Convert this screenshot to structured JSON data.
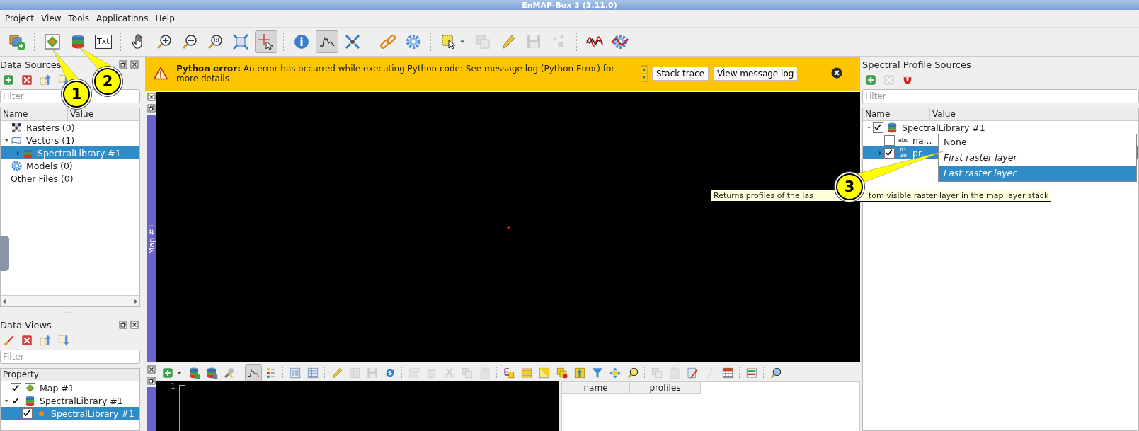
{
  "window": {
    "title": "EnMAP-Box 3 (3.11.0)"
  },
  "menu": [
    "Project",
    "View",
    "Tools",
    "Applications",
    "Help"
  ],
  "toolbar": [
    {
      "pressed": false,
      "disabled": false
    },
    {
      "pressed": false,
      "disabled": false
    },
    {
      "pressed": false,
      "disabled": false
    },
    {
      "pressed": false,
      "disabled": false,
      "label": "Txt"
    },
    {
      "pressed": false,
      "disabled": false
    },
    {
      "pressed": false,
      "disabled": false
    },
    {
      "pressed": false,
      "disabled": false
    },
    {
      "pressed": false,
      "disabled": false
    },
    {
      "pressed": false,
      "disabled": false
    },
    {
      "pressed": true,
      "disabled": false
    },
    {
      "pressed": false,
      "disabled": false
    },
    {
      "pressed": true,
      "disabled": false
    },
    {
      "pressed": false,
      "disabled": false
    },
    {
      "pressed": false,
      "disabled": false
    },
    {
      "pressed": false,
      "disabled": false
    },
    {
      "pressed": false,
      "disabled": false
    },
    {
      "pressed": false,
      "disabled": true
    },
    {
      "pressed": false,
      "disabled": false
    },
    {
      "pressed": false,
      "disabled": true
    },
    {
      "pressed": false,
      "disabled": true
    },
    {
      "pressed": false,
      "disabled": false
    },
    {
      "pressed": false,
      "disabled": false
    }
  ],
  "data_sources": {
    "title": "Data Sources",
    "filter": {
      "placeholder": "Filter"
    },
    "columns": [
      "Name",
      "Value"
    ],
    "tree": [
      {
        "label": "Rasters (0)",
        "selected": false
      },
      {
        "label": "Vectors (1)",
        "selected": false,
        "expanded": true,
        "children": [
          {
            "label": "SpectralLibrary #1",
            "selected": true,
            "expanded": false
          }
        ]
      },
      {
        "label": "Models (0)",
        "selected": false
      },
      {
        "label": "Other Files (0)",
        "selected": false
      }
    ]
  },
  "data_views": {
    "title": "Data Views",
    "filter": {
      "placeholder": "Filter"
    },
    "columns": [
      "Property"
    ],
    "tree": [
      {
        "label": "Map #1",
        "selected": false,
        "checked": true
      },
      {
        "label": "SpectralLibrary #1",
        "selected": false,
        "checked": true,
        "expanded": true,
        "children": [
          {
            "label": "SpectralLibrary #1",
            "selected": true,
            "checked": true
          }
        ]
      }
    ]
  },
  "error_bar": {
    "message": "**Python error:** An error has occurred while executing Python code: See message log (Python Error) for more details",
    "buttons": [
      "Stack trace",
      "View message log"
    ]
  },
  "map_dock": {
    "title": "Map #1"
  },
  "library_dock": {
    "line_number": "1",
    "columns": [
      "name",
      "profiles"
    ],
    "toolbar": [
      {
        "pressed": false,
        "disabled": false
      },
      {
        "pressed": false,
        "disabled": false
      },
      {
        "pressed": false,
        "disabled": false
      },
      {
        "pressed": false,
        "disabled": false
      },
      {
        "pressed": true,
        "disabled": false
      },
      {
        "pressed": false,
        "disabled": false
      },
      {
        "pressed": false,
        "disabled": false
      },
      {
        "pressed": false,
        "disabled": false
      },
      {
        "pressed": false,
        "disabled": false
      },
      {
        "pressed": false,
        "disabled": true
      },
      {
        "pressed": false,
        "disabled": true
      },
      {
        "pressed": false,
        "disabled": false
      },
      {
        "pressed": false,
        "disabled": true
      },
      {
        "pressed": false,
        "disabled": true
      },
      {
        "pressed": false,
        "disabled": true
      },
      {
        "pressed": false,
        "disabled": true
      },
      {
        "pressed": false,
        "disabled": true
      },
      {
        "pressed": false,
        "disabled": false
      },
      {
        "pressed": false,
        "disabled": false
      },
      {
        "pressed": false,
        "disabled": false
      },
      {
        "pressed": false,
        "disabled": false
      },
      {
        "pressed": false,
        "disabled": false
      },
      {
        "pressed": false,
        "disabled": false
      },
      {
        "pressed": false,
        "disabled": false
      },
      {
        "pressed": false,
        "disabled": false
      },
      {
        "pressed": false,
        "disabled": true
      },
      {
        "pressed": false,
        "disabled": true
      },
      {
        "pressed": false,
        "disabled": false
      },
      {
        "pressed": false,
        "disabled": true
      },
      {
        "pressed": false,
        "disabled": false
      },
      {
        "pressed": false,
        "disabled": false
      },
      {
        "pressed": false,
        "disabled": false
      }
    ]
  },
  "profile_sources": {
    "title": "Spectral Profile Sources",
    "filter": {
      "placeholder": "Filter"
    },
    "columns": [
      "Name",
      "Value"
    ],
    "tree": [
      {
        "label": "SpectralLibrary #1",
        "selected": false,
        "checked": true,
        "expanded": true,
        "children": [
          {
            "label": "na...",
            "type_label": "abc",
            "selected": false,
            "checked": false
          },
          {
            "label": "pr...",
            "type_label": "01 10",
            "selected": true,
            "checked": true,
            "expanded": false
          }
        ]
      }
    ]
  },
  "dropdown": {
    "options": [
      {
        "label": "None",
        "kind": "none",
        "selected": false
      },
      {
        "label": "First raster layer",
        "kind": "layer",
        "selected": false
      },
      {
        "label": "Last raster layer",
        "kind": "layer",
        "selected": true
      }
    ]
  },
  "tooltip": {
    "parts": [
      "Returns profiles of the las",
      "tom visible raster layer in the map layer stack"
    ]
  },
  "callouts": [
    {
      "label": "1"
    },
    {
      "label": "2"
    },
    {
      "label": "3"
    }
  ]
}
